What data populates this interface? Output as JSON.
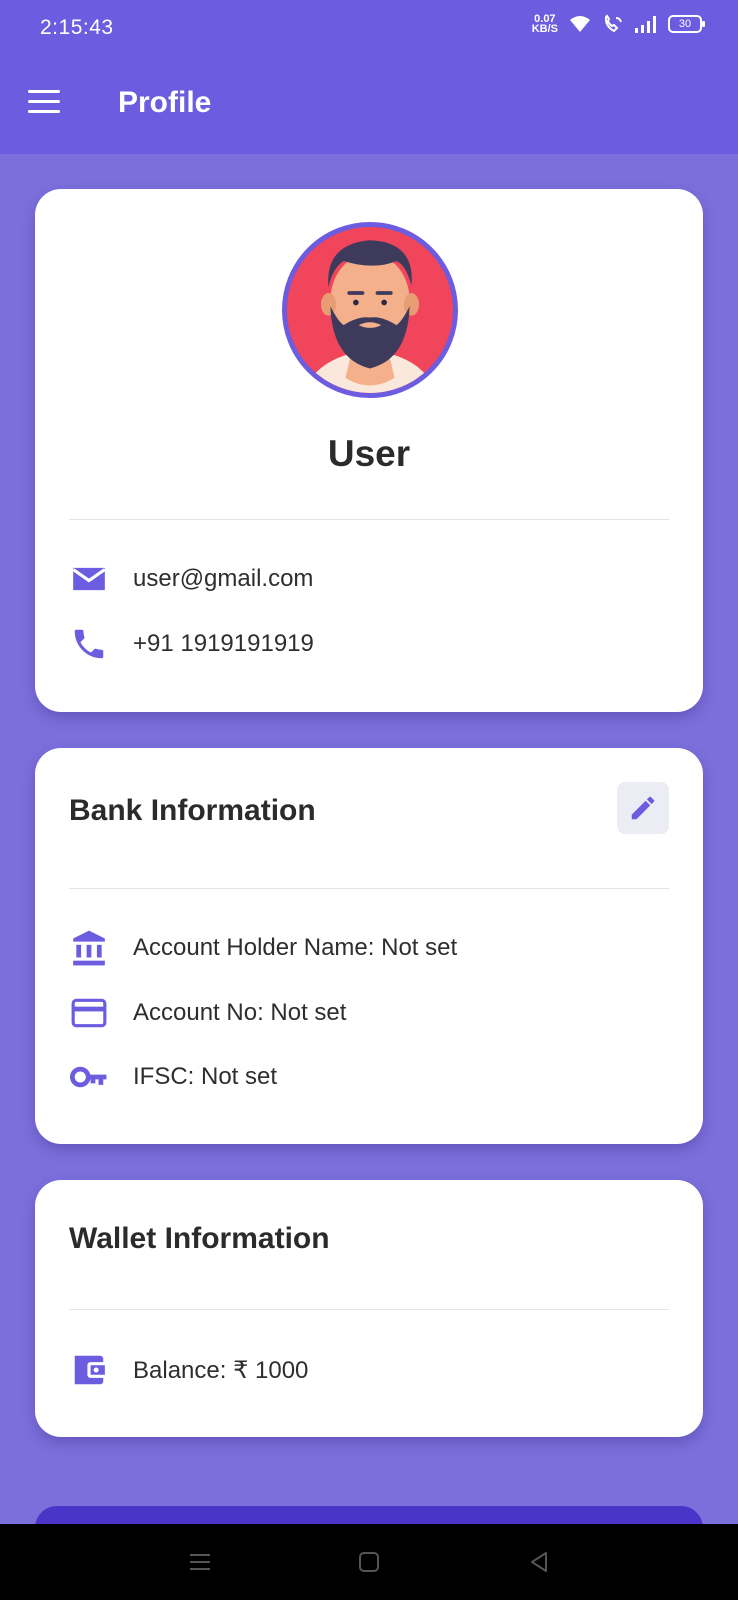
{
  "status_bar": {
    "time": "2:15:43",
    "net_speed_value": "0.07",
    "net_speed_unit": "KB/S",
    "battery": "30"
  },
  "app_bar": {
    "title": "Profile",
    "menu_icon": "hamburger-menu-icon"
  },
  "profile": {
    "avatar_icon": "bearded-man-avatar",
    "name": "User",
    "email": "user@gmail.com",
    "phone": "+91 1919191919"
  },
  "bank": {
    "title": "Bank Information",
    "account_holder": "Account Holder Name: Not set",
    "account_no": "Account No: Not set",
    "ifsc": "IFSC: Not set"
  },
  "wallet": {
    "title": "Wallet Information",
    "balance": "Balance: ₹ 1000"
  },
  "colors": {
    "primary": "#6c5ce0",
    "background": "#7c6fdc",
    "card": "#ffffff",
    "avatar_bg": "#f0455a"
  }
}
